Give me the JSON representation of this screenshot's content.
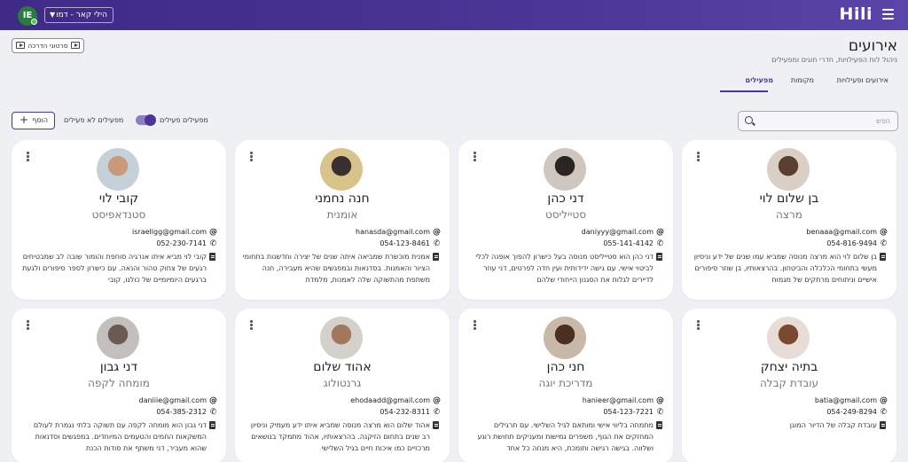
{
  "header": {
    "logo": "Hili",
    "user_initials": "IE",
    "org_selector": "הילי קאר - דמו"
  },
  "guide_button": "סרטוני הדרכה",
  "page": {
    "title": "אירועים",
    "subtitle": "ניהול לוח הפעילויות, חדרי חוגים ומפעילים"
  },
  "tabs": [
    {
      "label": "אירועים ופעילויות"
    },
    {
      "label": "מקומות"
    },
    {
      "label": "מפעילים",
      "active": true
    }
  ],
  "toolbar": {
    "search_placeholder": "חפש",
    "active_label": "מפעילים פעילים",
    "inactive_label": "מפעילים לא פעילים",
    "toggle_on": true,
    "add_label": "הוסף"
  },
  "cards": [
    {
      "name": "בן שלום לוי",
      "role": "מרצה",
      "email": "benaaa@gmail.com",
      "phone": "054-816-9494",
      "bio": "בן שלום לוי הוא מרצה מנוסה שמביא עמו שנים של ידע וניסיון מעשי בתחומי הכלכלה והביטחון. בהרצאותיו, בן שוזר סיפורים אישיים וניתוחים מרתקים של מגמות"
    },
    {
      "name": "דני כהן",
      "role": "סטייליסט",
      "email": "daniyyy@gmail.com",
      "phone": "055-141-4142",
      "bio": "דני כהן הוא סטייליסט מנוסה בעל כישרון להפוך אופנה לכלי לביטוי אישי. עם גישה ידידותית ועין חדה לפרטים, דני עוזר לדיירים לגלות את הסגנון הייחודי שלהם"
    },
    {
      "name": "חנה נחמני",
      "role": "אומנית",
      "email": "hanasda@gmail.com",
      "phone": "054-123-8461",
      "bio": "אמנית מוכשרת שמביאה איתה שנים של יצירה וחדשנות בתחומי הציור והאמנות. בסדנאות ובמפגשים שהיא מעבירה, חנה משתפת מהתשוקה שלה לאמנות, מלמדת"
    },
    {
      "name": "קובי לוי",
      "role": "סטנדאפיסט",
      "email": "israellgg@gmail.com",
      "phone": "052-230-7141",
      "bio": "קובי לוי מביא איתו אנרגיה סוחפת והומור שובה לב שמבטיחים רגעים של צחוק טהור והנאה. עם כישרון לספר סיפורים ולגעת ברגעים היומיומיים של כולנו, קובי"
    },
    {
      "name": "בתיה יצחק",
      "role": "עובדת קבלה",
      "email": "batia@gmail.com",
      "phone": "054-249-8294",
      "bio": "עובדת קבלה של הדיור המוגן"
    },
    {
      "name": "חני כהן",
      "role": "מדריכת יוגה",
      "email": "hanieer@gmail.com",
      "phone": "054-123-7221",
      "bio": "מתמחה בליווי אישי ומותאם לגיל השלישי. עם תרגילים המחזקים את הגוף, משפרים גמישות ומעניקים תחושת רוגע ושלווה. בגישה רגישה ותומכת, היא מנחה כל אחד"
    },
    {
      "name": "אהוד שלום",
      "role": "גרנטולוג",
      "email": "ehodaadd@gmail.com",
      "phone": "054-232-8311",
      "bio": "אהוד שלום הוא מרצה מנוסה שמביא איתו ידע מעמיק וניסיון רב שנים בתחום הזיקנה. בהרצאותיו, אהוד מתמקד בנושאים מרכזיים כמו איכות חיים בגיל השלישי"
    },
    {
      "name": "דני גבון",
      "role": "מומחה לקפה",
      "email": "daniiie@gmail.com",
      "phone": "054-385-2312",
      "bio": "דני גבון הוא מומחה לקפה עם תשוקה בלתי נגמרת לעולם המשקאות החמים והטעמים המיוחדים. במפגשים וסדנאות שהוא מעביר, דני משתף את סודות הכנת"
    }
  ],
  "colors": {
    "brand": "#4b3596",
    "toggle_track": "#8b7ec3",
    "online": "#49c35a"
  }
}
